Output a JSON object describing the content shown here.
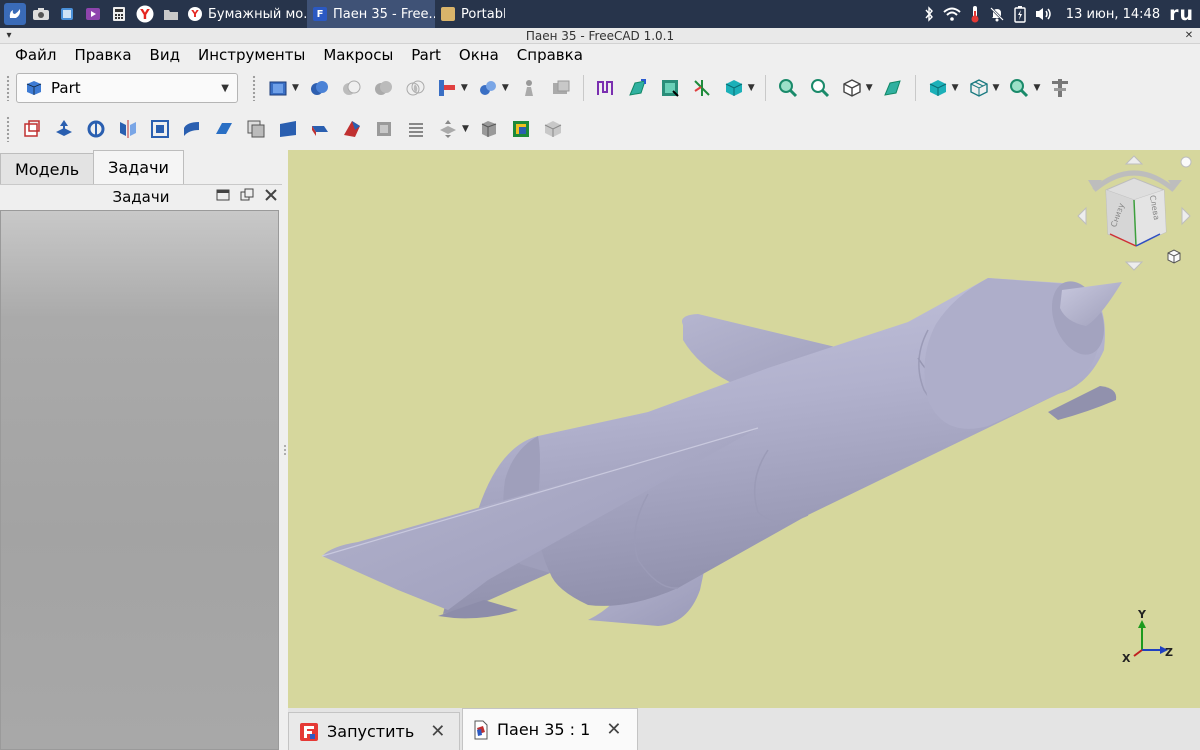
{
  "taskbar": {
    "tasks": [
      {
        "label": "Бумажный мо..."
      },
      {
        "label": "Паен 35 - Free..."
      },
      {
        "label": "Portabl"
      }
    ],
    "clock": "13 июн, 14:48",
    "lang": "ru"
  },
  "window": {
    "title": "Паен 35 - FreeCAD 1.0.1"
  },
  "menu": [
    "Файл",
    "Правка",
    "Вид",
    "Инструменты",
    "Макросы",
    "Part",
    "Окна",
    "Справка"
  ],
  "workbench": {
    "selected": "Part"
  },
  "left_panel": {
    "tabs": [
      "Модель",
      "Задачи"
    ],
    "active_tab": "Задачи",
    "title": "Задачи"
  },
  "navcube": {
    "left_face": "Снизу",
    "right_face": "Слева"
  },
  "axes": {
    "x": "X",
    "y": "Y",
    "z": "Z"
  },
  "doc_tabs": [
    {
      "label": "Запустить"
    },
    {
      "label": "Паен 35 : 1"
    }
  ],
  "colors": {
    "viewport_bg": "#d6d79d",
    "model": "#a9a9c9",
    "taskbar": "#27344b"
  }
}
